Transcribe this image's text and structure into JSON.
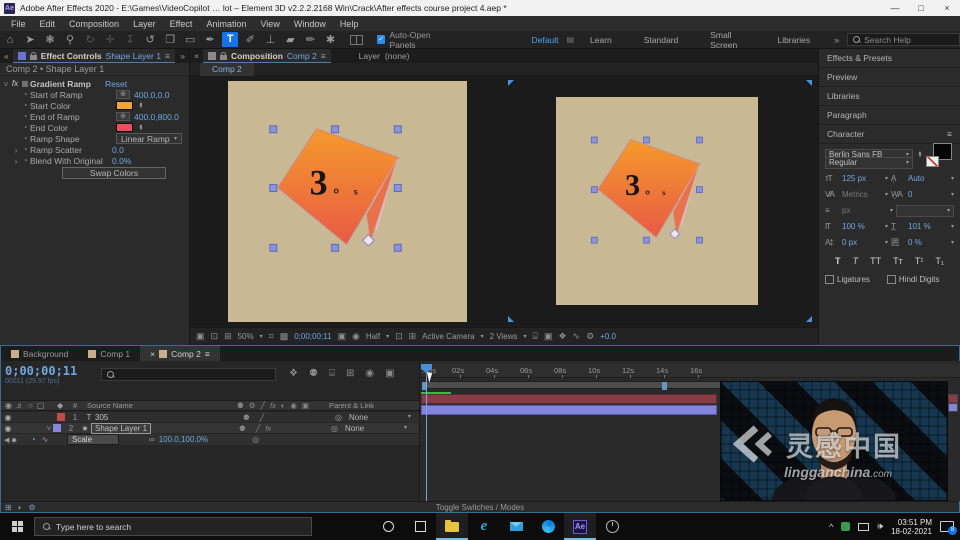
{
  "colors": {
    "accent": "#1473e6",
    "value_blue": "#6fa8e0",
    "start_color": "#f0a437",
    "end_color": "#e8505e",
    "canvas_tan": "#c9b894",
    "layer1_bar": "#8a3c46",
    "layer2_bar": "#8285db"
  },
  "icons": {
    "home": "⌂",
    "selection": "➤",
    "hand": "❃",
    "zoom_tool": "⚲",
    "orbit": "↻",
    "pan": "✛",
    "down": "↧",
    "rotate": "↺",
    "camera_tool": "❐",
    "shape": "▭",
    "pen": "✒",
    "type": "T",
    "brush": "✐",
    "stamp": "⊥",
    "eraser": "▰",
    "rotobrush": "✏",
    "puppet": "✱",
    "ws_menu": "▤",
    "chevrons": "»",
    "back": "«",
    "menu": "≡",
    "close": "×",
    "caret": "▾",
    "twirl_open": "˅",
    "twirl_closed": "›",
    "fx": "fx",
    "effect_badge": "▦",
    "point": "⊕",
    "minimize": "—",
    "maximize": "□",
    "eye": "◉",
    "speaker": "♬",
    "solo": "○",
    "lockbox": "▢",
    "shy": "⚉",
    "quality": "╱",
    "blur": "◐",
    "flow": "❖",
    "frameblend": "⊞",
    "motionblur": "◉",
    "graph": "∿",
    "adjust": "⌸",
    "boxic": "▣",
    "pickwhip": "◎",
    "star": "★",
    "stopwatch": "◔",
    "graphprop": "∿",
    "kf_left": "◀",
    "kf_diamond": "◆",
    "monitor": "🖵",
    "grid2": "⊞",
    "snapshot": "▣",
    "channels": "◉",
    "roi": "⊡",
    "transp": "▩",
    "ruler_ic": "⌗",
    "flow2": "♟",
    "gear": "⚙",
    "tray_up": "^",
    "display_ic": "🖵"
  },
  "titlebar": {
    "title": "Adobe After Effects 2020 - E:\\Games\\VideoCopilot … lot – Element 3D v2.2.2.2168 Win\\Crack\\After effects course project 4.aep *",
    "app_badge": "Ae"
  },
  "menubar": {
    "items": [
      "File",
      "Edit",
      "Composition",
      "Layer",
      "Effect",
      "Animation",
      "View",
      "Window",
      "Help"
    ]
  },
  "toolbar": {
    "auto_open": "Auto-Open Panels",
    "check": "✓",
    "workspaces": [
      "Default",
      "Learn",
      "Standard",
      "Small Screen",
      "Libraries"
    ],
    "search_placeholder": "Search Help"
  },
  "effect_controls": {
    "tab_label": "Effect Controls",
    "tab_target": "Shape Layer 1",
    "breadcrumb": "Comp 2 • Shape Layer 1",
    "effect_name": "Gradient Ramp",
    "reset": "Reset",
    "rows": {
      "start_of_ramp": {
        "label": "Start of Ramp",
        "value": "400.0,0.0"
      },
      "start_color": {
        "label": "Start Color"
      },
      "end_of_ramp": {
        "label": "End of Ramp",
        "value": "400.0,800.0"
      },
      "end_color": {
        "label": "End Color"
      },
      "ramp_shape": {
        "label": "Ramp Shape",
        "value": "Linear Ramp"
      },
      "ramp_scatter": {
        "label": "Ramp Scatter",
        "value": "0.0"
      },
      "blend": {
        "label": "Blend With Original",
        "value": "0.0%"
      }
    },
    "swap_colors": "Swap Colors"
  },
  "composition": {
    "tab_label": "Composition",
    "tab_target": "Comp 2",
    "layer_label": "Layer",
    "layer_value": "(none)",
    "comp_tab": "Comp 2",
    "canvas": {
      "big_text": "3",
      "small_1": "0",
      "small_2": "5"
    },
    "footer": {
      "zoom": "50%",
      "timecode": "0;00;00;11",
      "resolution": "Half",
      "camera": "Active Camera",
      "views": "2 Views",
      "exposure": "+0.0"
    }
  },
  "right_panels": {
    "h1": "Effects & Presets",
    "h2": "Preview",
    "h3": "Libraries",
    "h4": "Paragraph"
  },
  "character": {
    "title": "Character",
    "font": "Berlin Sans FB",
    "style": "Regular",
    "size": "125 px",
    "leading": "Auto",
    "kerning": "Metrics",
    "tracking": "0",
    "stroke_width": "px",
    "v_scale": "100 %",
    "h_scale": "101 %",
    "baseline": "0 px",
    "tsume": "0 %",
    "style_buttons": {
      "b1": "T",
      "b2": "T",
      "b3": "TT",
      "b4": "Tᴛ",
      "b5": "T¹",
      "b6": "T₁"
    },
    "ligatures": "Ligatures",
    "hindi": "Hindi Digits",
    "ico_size": "тT",
    "ico_leading": "A͎",
    "ico_kern": "V⁄A",
    "ico_track": "W̱A",
    "ico_stroke": "≡",
    "ico_vscale": "IT",
    "ico_hscale": "T̲",
    "ico_base": "A‡",
    "ico_tsume": "囲"
  },
  "timeline": {
    "tabs": [
      "Background",
      "Comp 1",
      "Comp 2"
    ],
    "timecode": "0;00;00;11",
    "frame_info": "00011 (29.97 fps)",
    "source_name_header": "Source Name",
    "parent_link_header": "Parent & Link",
    "layers": {
      "l1": {
        "num": "1",
        "name": "305",
        "parent": "None"
      },
      "l2": {
        "num": "2",
        "name": "Shape Layer 1",
        "parent": "None"
      }
    },
    "property": {
      "name": "Scale",
      "value": "100.0,100.0%"
    },
    "ruler": {
      "t0": ":00s",
      "t1": "02s",
      "t2": "04s",
      "t3": "06s",
      "t4": "08s",
      "t5": "10s",
      "t6": "12s",
      "t7": "14s",
      "t8": "16s"
    },
    "toggle": "Toggle Switches / Modes"
  },
  "watermark": {
    "cn": "灵感中国",
    "url_bold": "lingganchina",
    "url_tld": ".com"
  },
  "taskbar": {
    "search_placeholder": "Type here to search",
    "time": "03:51 PM",
    "date": "18-02-2021",
    "badge": "8"
  }
}
